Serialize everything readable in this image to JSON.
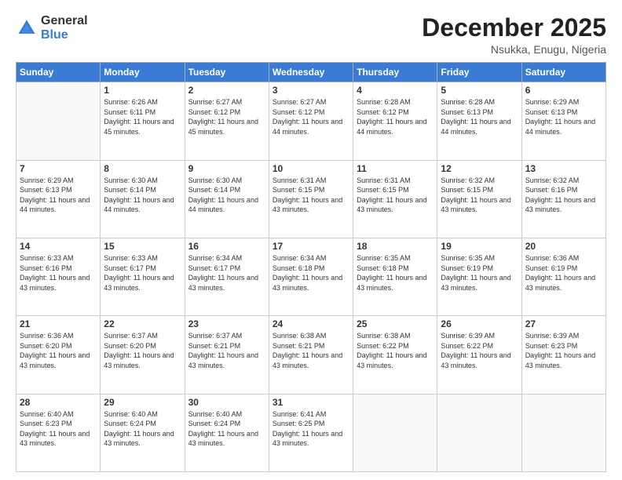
{
  "header": {
    "logo_general": "General",
    "logo_blue": "Blue",
    "month_title": "December 2025",
    "location": "Nsukka, Enugu, Nigeria"
  },
  "weekdays": [
    "Sunday",
    "Monday",
    "Tuesday",
    "Wednesday",
    "Thursday",
    "Friday",
    "Saturday"
  ],
  "weeks": [
    [
      {
        "day": "",
        "sunrise": "",
        "sunset": "",
        "daylight": ""
      },
      {
        "day": "1",
        "sunrise": "Sunrise: 6:26 AM",
        "sunset": "Sunset: 6:11 PM",
        "daylight": "Daylight: 11 hours and 45 minutes."
      },
      {
        "day": "2",
        "sunrise": "Sunrise: 6:27 AM",
        "sunset": "Sunset: 6:12 PM",
        "daylight": "Daylight: 11 hours and 45 minutes."
      },
      {
        "day": "3",
        "sunrise": "Sunrise: 6:27 AM",
        "sunset": "Sunset: 6:12 PM",
        "daylight": "Daylight: 11 hours and 44 minutes."
      },
      {
        "day": "4",
        "sunrise": "Sunrise: 6:28 AM",
        "sunset": "Sunset: 6:12 PM",
        "daylight": "Daylight: 11 hours and 44 minutes."
      },
      {
        "day": "5",
        "sunrise": "Sunrise: 6:28 AM",
        "sunset": "Sunset: 6:13 PM",
        "daylight": "Daylight: 11 hours and 44 minutes."
      },
      {
        "day": "6",
        "sunrise": "Sunrise: 6:29 AM",
        "sunset": "Sunset: 6:13 PM",
        "daylight": "Daylight: 11 hours and 44 minutes."
      }
    ],
    [
      {
        "day": "7",
        "sunrise": "Sunrise: 6:29 AM",
        "sunset": "Sunset: 6:13 PM",
        "daylight": "Daylight: 11 hours and 44 minutes."
      },
      {
        "day": "8",
        "sunrise": "Sunrise: 6:30 AM",
        "sunset": "Sunset: 6:14 PM",
        "daylight": "Daylight: 11 hours and 44 minutes."
      },
      {
        "day": "9",
        "sunrise": "Sunrise: 6:30 AM",
        "sunset": "Sunset: 6:14 PM",
        "daylight": "Daylight: 11 hours and 44 minutes."
      },
      {
        "day": "10",
        "sunrise": "Sunrise: 6:31 AM",
        "sunset": "Sunset: 6:15 PM",
        "daylight": "Daylight: 11 hours and 43 minutes."
      },
      {
        "day": "11",
        "sunrise": "Sunrise: 6:31 AM",
        "sunset": "Sunset: 6:15 PM",
        "daylight": "Daylight: 11 hours and 43 minutes."
      },
      {
        "day": "12",
        "sunrise": "Sunrise: 6:32 AM",
        "sunset": "Sunset: 6:15 PM",
        "daylight": "Daylight: 11 hours and 43 minutes."
      },
      {
        "day": "13",
        "sunrise": "Sunrise: 6:32 AM",
        "sunset": "Sunset: 6:16 PM",
        "daylight": "Daylight: 11 hours and 43 minutes."
      }
    ],
    [
      {
        "day": "14",
        "sunrise": "Sunrise: 6:33 AM",
        "sunset": "Sunset: 6:16 PM",
        "daylight": "Daylight: 11 hours and 43 minutes."
      },
      {
        "day": "15",
        "sunrise": "Sunrise: 6:33 AM",
        "sunset": "Sunset: 6:17 PM",
        "daylight": "Daylight: 11 hours and 43 minutes."
      },
      {
        "day": "16",
        "sunrise": "Sunrise: 6:34 AM",
        "sunset": "Sunset: 6:17 PM",
        "daylight": "Daylight: 11 hours and 43 minutes."
      },
      {
        "day": "17",
        "sunrise": "Sunrise: 6:34 AM",
        "sunset": "Sunset: 6:18 PM",
        "daylight": "Daylight: 11 hours and 43 minutes."
      },
      {
        "day": "18",
        "sunrise": "Sunrise: 6:35 AM",
        "sunset": "Sunset: 6:18 PM",
        "daylight": "Daylight: 11 hours and 43 minutes."
      },
      {
        "day": "19",
        "sunrise": "Sunrise: 6:35 AM",
        "sunset": "Sunset: 6:19 PM",
        "daylight": "Daylight: 11 hours and 43 minutes."
      },
      {
        "day": "20",
        "sunrise": "Sunrise: 6:36 AM",
        "sunset": "Sunset: 6:19 PM",
        "daylight": "Daylight: 11 hours and 43 minutes."
      }
    ],
    [
      {
        "day": "21",
        "sunrise": "Sunrise: 6:36 AM",
        "sunset": "Sunset: 6:20 PM",
        "daylight": "Daylight: 11 hours and 43 minutes."
      },
      {
        "day": "22",
        "sunrise": "Sunrise: 6:37 AM",
        "sunset": "Sunset: 6:20 PM",
        "daylight": "Daylight: 11 hours and 43 minutes."
      },
      {
        "day": "23",
        "sunrise": "Sunrise: 6:37 AM",
        "sunset": "Sunset: 6:21 PM",
        "daylight": "Daylight: 11 hours and 43 minutes."
      },
      {
        "day": "24",
        "sunrise": "Sunrise: 6:38 AM",
        "sunset": "Sunset: 6:21 PM",
        "daylight": "Daylight: 11 hours and 43 minutes."
      },
      {
        "day": "25",
        "sunrise": "Sunrise: 6:38 AM",
        "sunset": "Sunset: 6:22 PM",
        "daylight": "Daylight: 11 hours and 43 minutes."
      },
      {
        "day": "26",
        "sunrise": "Sunrise: 6:39 AM",
        "sunset": "Sunset: 6:22 PM",
        "daylight": "Daylight: 11 hours and 43 minutes."
      },
      {
        "day": "27",
        "sunrise": "Sunrise: 6:39 AM",
        "sunset": "Sunset: 6:23 PM",
        "daylight": "Daylight: 11 hours and 43 minutes."
      }
    ],
    [
      {
        "day": "28",
        "sunrise": "Sunrise: 6:40 AM",
        "sunset": "Sunset: 6:23 PM",
        "daylight": "Daylight: 11 hours and 43 minutes."
      },
      {
        "day": "29",
        "sunrise": "Sunrise: 6:40 AM",
        "sunset": "Sunset: 6:24 PM",
        "daylight": "Daylight: 11 hours and 43 minutes."
      },
      {
        "day": "30",
        "sunrise": "Sunrise: 6:40 AM",
        "sunset": "Sunset: 6:24 PM",
        "daylight": "Daylight: 11 hours and 43 minutes."
      },
      {
        "day": "31",
        "sunrise": "Sunrise: 6:41 AM",
        "sunset": "Sunset: 6:25 PM",
        "daylight": "Daylight: 11 hours and 43 minutes."
      },
      {
        "day": "",
        "sunrise": "",
        "sunset": "",
        "daylight": ""
      },
      {
        "day": "",
        "sunrise": "",
        "sunset": "",
        "daylight": ""
      },
      {
        "day": "",
        "sunrise": "",
        "sunset": "",
        "daylight": ""
      }
    ]
  ]
}
